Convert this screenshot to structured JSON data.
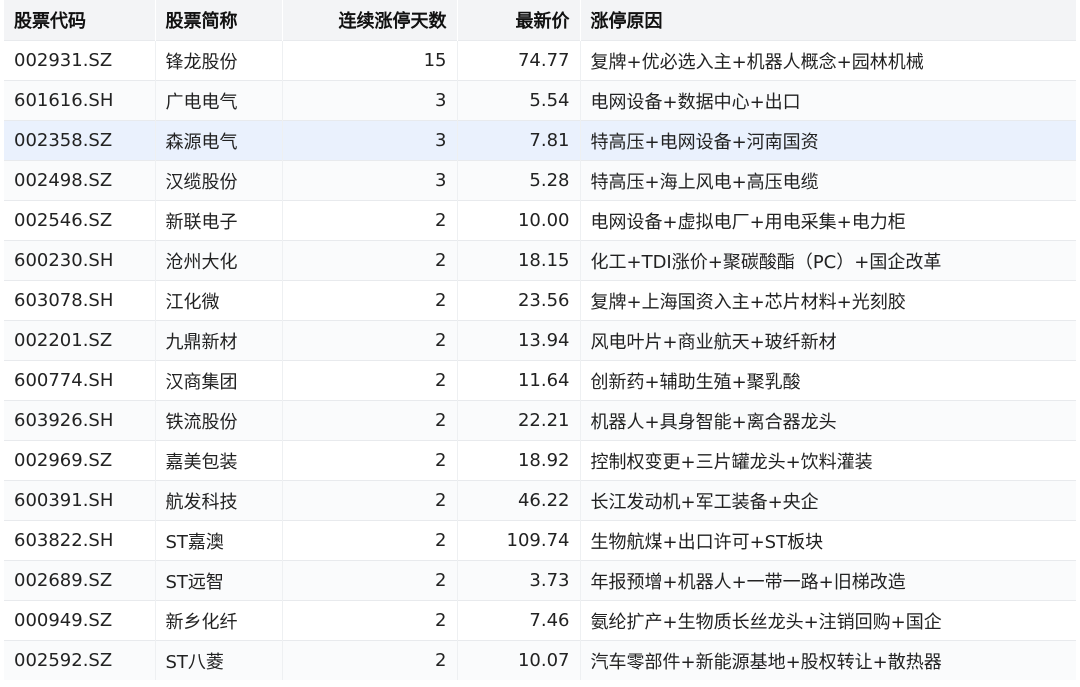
{
  "table": {
    "headers": {
      "code": "股票代码",
      "name": "股票简称",
      "days": "连续涨停天数",
      "price": "最新价",
      "reason": "涨停原因"
    },
    "rows": [
      {
        "code": "002931.SZ",
        "name": "锋龙股份",
        "days": "15",
        "price": "74.77",
        "reason": "复牌+优必选入主+机器人概念+园林机械"
      },
      {
        "code": "601616.SH",
        "name": "广电电气",
        "days": "3",
        "price": "5.54",
        "reason": "电网设备+数据中心+出口"
      },
      {
        "code": "002358.SZ",
        "name": "森源电气",
        "days": "3",
        "price": "7.81",
        "reason": "特高压+电网设备+河南国资"
      },
      {
        "code": "002498.SZ",
        "name": "汉缆股份",
        "days": "3",
        "price": "5.28",
        "reason": "特高压+海上风电+高压电缆"
      },
      {
        "code": "002546.SZ",
        "name": "新联电子",
        "days": "2",
        "price": "10.00",
        "reason": "电网设备+虚拟电厂+用电采集+电力柜"
      },
      {
        "code": "600230.SH",
        "name": "沧州大化",
        "days": "2",
        "price": "18.15",
        "reason": "化工+TDI涨价+聚碳酸酯（PC）+国企改革"
      },
      {
        "code": "603078.SH",
        "name": "江化微",
        "days": "2",
        "price": "23.56",
        "reason": "复牌+上海国资入主+芯片材料+光刻胶"
      },
      {
        "code": "002201.SZ",
        "name": "九鼎新材",
        "days": "2",
        "price": "13.94",
        "reason": "风电叶片+商业航天+玻纤新材"
      },
      {
        "code": "600774.SH",
        "name": "汉商集团",
        "days": "2",
        "price": "11.64",
        "reason": "创新药+辅助生殖+聚乳酸"
      },
      {
        "code": "603926.SH",
        "name": "铁流股份",
        "days": "2",
        "price": "22.21",
        "reason": "机器人+具身智能+离合器龙头"
      },
      {
        "code": "002969.SZ",
        "name": "嘉美包装",
        "days": "2",
        "price": "18.92",
        "reason": "控制权变更+三片罐龙头+饮料灌装"
      },
      {
        "code": "600391.SH",
        "name": "航发科技",
        "days": "2",
        "price": "46.22",
        "reason": "长江发动机+军工装备+央企"
      },
      {
        "code": "603822.SH",
        "name": "ST嘉澳",
        "days": "2",
        "price": "109.74",
        "reason": "生物航煤+出口许可+ST板块"
      },
      {
        "code": "002689.SZ",
        "name": "ST远智",
        "days": "2",
        "price": "3.73",
        "reason": "年报预增+机器人+一带一路+旧梯改造"
      },
      {
        "code": "000949.SZ",
        "name": "新乡化纤",
        "days": "2",
        "price": "7.46",
        "reason": "氨纶扩产+生物质长丝龙头+注销回购+国企"
      },
      {
        "code": "002592.SZ",
        "name": "ST八菱",
        "days": "2",
        "price": "10.07",
        "reason": "汽车零部件+新能源基地+股权转让+散热器"
      }
    ],
    "highlight_color": "#eaf1fd"
  }
}
